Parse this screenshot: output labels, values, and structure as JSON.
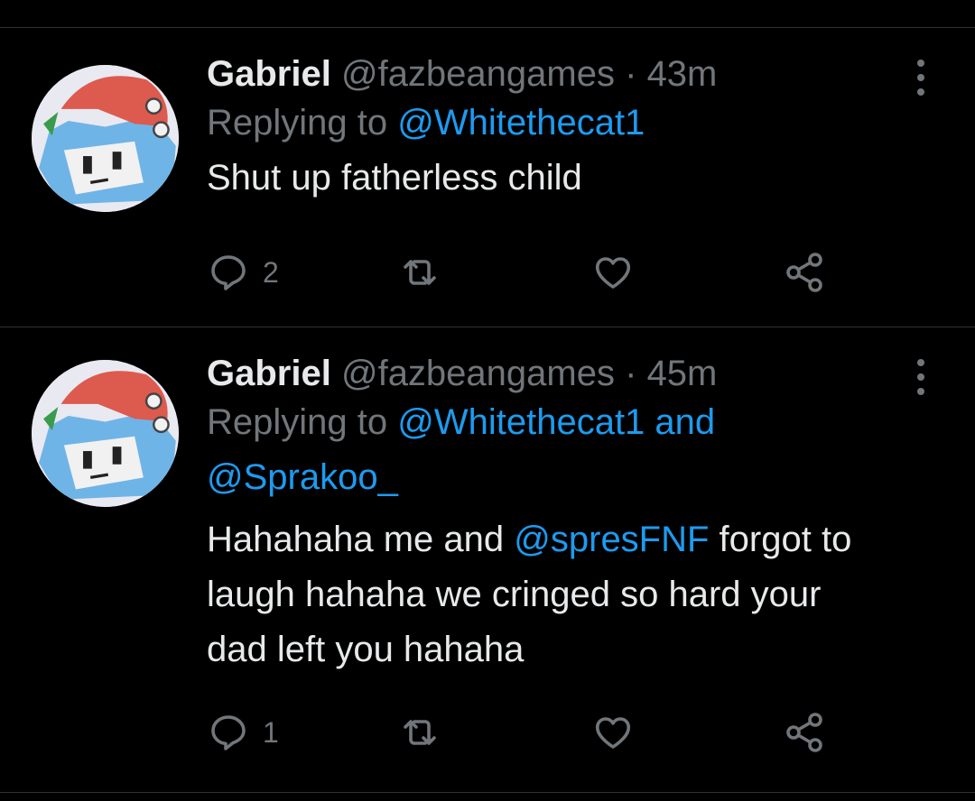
{
  "tweets": [
    {
      "name": "Gabriel",
      "handle": "@fazbeangames",
      "separator": "·",
      "time": "43m",
      "replying_prefix": "Replying to ",
      "reply_mention_1": "@Whitethecat1",
      "text": "Shut up fatherless child",
      "reply_count": "2"
    },
    {
      "name": "Gabriel",
      "handle": "@fazbeangames",
      "separator": "·",
      "time": "45m",
      "replying_prefix": "Replying to ",
      "reply_mention_1": "@Whitethecat1",
      "reply_and": " and",
      "reply_mention_2": "@Sprakoo_",
      "text_part_1": "Hahahaha me and ",
      "text_mention": "@spresFNF",
      "text_part_2": " forgot to",
      "text_line_2": "laugh hahaha we cringed so hard your",
      "text_line_3": "dad left you hahaha",
      "reply_count": "1"
    }
  ],
  "icons": {
    "reply": "reply-icon",
    "retweet": "retweet-icon",
    "like": "heart-icon",
    "share": "share-icon",
    "more": "more-options-icon"
  },
  "colors": {
    "background": "#000000",
    "primary_text": "#e7e9ea",
    "secondary_text": "#71767b",
    "link": "#1d9bf0",
    "divider": "#2f3336"
  }
}
